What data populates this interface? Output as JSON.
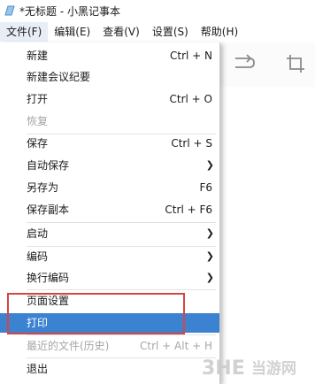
{
  "window": {
    "title": "*无标题 - 小黑记事本"
  },
  "menubar": {
    "items": [
      {
        "label": "文件(F)",
        "active": true
      },
      {
        "label": "编辑(E)",
        "active": false
      },
      {
        "label": "查看(V)",
        "active": false
      },
      {
        "label": "设置(S)",
        "active": false
      },
      {
        "label": "帮助(H)",
        "active": false
      }
    ]
  },
  "toolbar": {
    "icons": [
      "redo-icon",
      "crop-icon"
    ]
  },
  "file_menu": {
    "items": [
      {
        "label": "新建",
        "shortcut": "Ctrl + N",
        "submenu": false,
        "disabled": false,
        "selected": false
      },
      {
        "label": "新建会议纪要",
        "shortcut": "",
        "submenu": false,
        "disabled": false,
        "selected": false
      },
      {
        "label": "打开",
        "shortcut": "Ctrl + O",
        "submenu": false,
        "disabled": false,
        "selected": false
      },
      {
        "label": "恢复",
        "shortcut": "",
        "submenu": false,
        "disabled": true,
        "selected": false
      },
      {
        "label": "保存",
        "shortcut": "Ctrl + S",
        "submenu": false,
        "disabled": false,
        "selected": false
      },
      {
        "label": "自动保存",
        "shortcut": "",
        "submenu": true,
        "disabled": false,
        "selected": false
      },
      {
        "label": "另存为",
        "shortcut": "F6",
        "submenu": false,
        "disabled": false,
        "selected": false
      },
      {
        "label": "保存副本",
        "shortcut": "Ctrl + F6",
        "submenu": false,
        "disabled": false,
        "selected": false
      },
      {
        "label": "启动",
        "shortcut": "",
        "submenu": true,
        "disabled": false,
        "selected": false
      },
      {
        "label": "编码",
        "shortcut": "",
        "submenu": true,
        "disabled": false,
        "selected": false
      },
      {
        "label": "换行编码",
        "shortcut": "",
        "submenu": true,
        "disabled": false,
        "selected": false
      },
      {
        "label": "页面设置",
        "shortcut": "",
        "submenu": false,
        "disabled": false,
        "selected": false
      },
      {
        "label": "打印",
        "shortcut": "",
        "submenu": false,
        "disabled": false,
        "selected": true
      },
      {
        "label": "最近的文件(历史)",
        "shortcut": "Ctrl + Alt + H",
        "submenu": false,
        "disabled": true,
        "selected": false
      },
      {
        "label": "退出",
        "shortcut": "",
        "submenu": false,
        "disabled": false,
        "selected": false
      }
    ]
  },
  "watermark": {
    "brand": "3HE",
    "site": "当游网"
  },
  "colors": {
    "selection": "#3b82d0",
    "highlight_border": "#d64545",
    "disabled_text": "#a6a6a6",
    "app_icon": "#4a8fd6"
  }
}
